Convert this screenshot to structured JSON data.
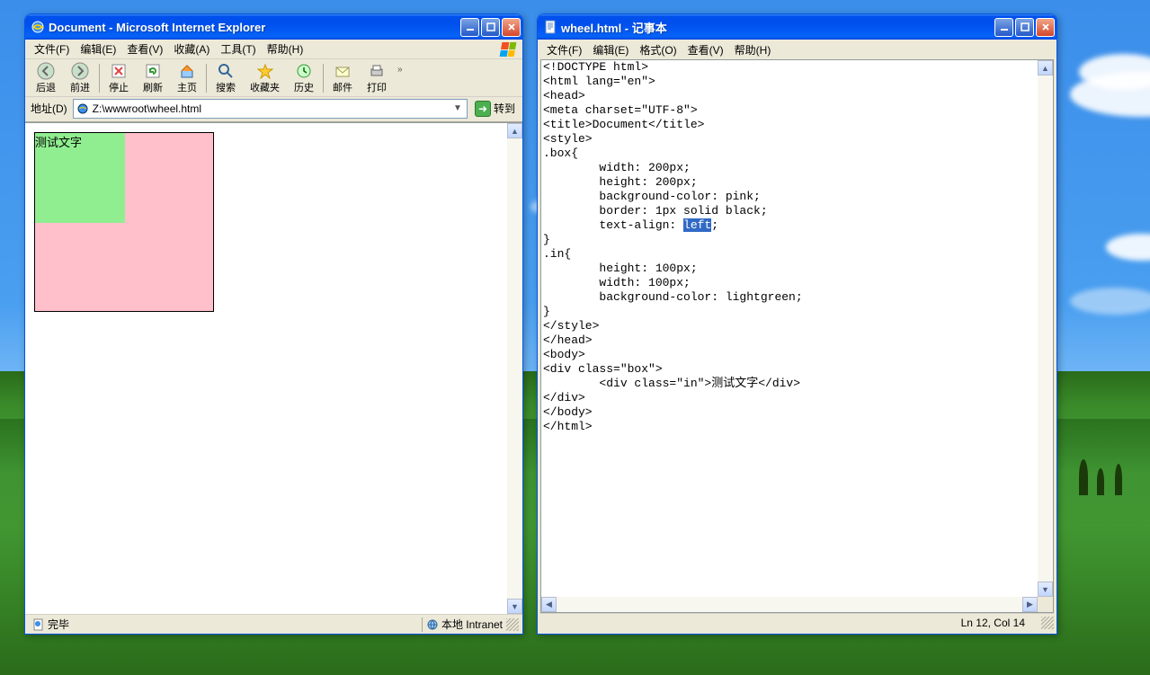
{
  "ie": {
    "title": "Document - Microsoft Internet Explorer",
    "menus": [
      "文件(F)",
      "编辑(E)",
      "查看(V)",
      "收藏(A)",
      "工具(T)",
      "帮助(H)"
    ],
    "toolbar": {
      "back": "后退",
      "forward": "前进",
      "stop": "停止",
      "refresh": "刷新",
      "home": "主页",
      "search": "搜索",
      "favorites": "收藏夹",
      "history": "历史",
      "mail": "邮件",
      "print": "打印"
    },
    "address_label": "地址(D)",
    "address_value": "Z:\\wwwroot\\wheel.html",
    "go": "转到",
    "content_text": "测试文字",
    "status_done": "完毕",
    "status_zone": "本地 Intranet"
  },
  "np": {
    "title": "wheel.html - 记事本",
    "menus": [
      "文件(F)",
      "编辑(E)",
      "格式(O)",
      "查看(V)",
      "帮助(H)"
    ],
    "lines": [
      "<!DOCTYPE html>",
      "<html lang=\"en\">",
      "<head>",
      "<meta charset=\"UTF-8\">",
      "<title>Document</title>",
      "<style>",
      ".box{",
      "        width: 200px;",
      "        height: 200px;",
      "        background-color: pink;",
      "        border: 1px solid black;",
      "        text-align: "
    ],
    "sel": "left",
    "after_sel": ";",
    "lines2": [
      "}",
      ".in{",
      "        height: 100px;",
      "        width: 100px;",
      "        background-color: lightgreen;",
      "}",
      "</style>",
      "</head>",
      "<body>",
      "<div class=\"box\">",
      "        <div class=\"in\">测试文字</div>",
      "</div>",
      "</body>",
      "</html>"
    ],
    "status_pos": "Ln 12, Col 14"
  }
}
